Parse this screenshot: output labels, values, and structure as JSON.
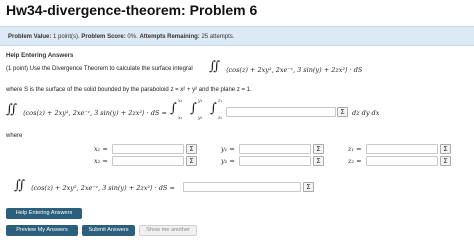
{
  "page": {
    "title": "Hw34-divergence-theorem: Problem 6"
  },
  "info_bar": {
    "value_label": "Problem Value:",
    "value": "1 point(s).",
    "score_label": "Problem Score:",
    "score": "0%.",
    "attempts_label": "Attempts Remaining:",
    "attempts": "25 attempts."
  },
  "help_header": "Help Entering Answers",
  "problem": {
    "prompt": "(1 point) Use the Divergence Theorem to calculate the surface integral",
    "vector_field": "⟨cos(z) + 2xy², 2xe⁻ᶻ, 3 sin(y) + 2zx²⟩ · dS",
    "where_text": "where S is the surface of the solid bounded by the paraboloid z = x² + y² and the plane z = 1.",
    "equation_lhs": "⟨cos(z) + 2xy², 2xe⁻ᶻ, 3 sin(y) + 2zx²⟩ · dS =",
    "integral_limits": {
      "outer_top": "x₁",
      "outer_bottom": "x₂",
      "middle_top": "y₁",
      "middle_bottom": "y₂",
      "inner_top": "z₁",
      "inner_bottom": "z₂"
    },
    "differentials": "dz dy dx",
    "where_label": "where",
    "limit_labels": {
      "x1": "x₁ =",
      "x2": "x₂ =",
      "y1": "y₁ =",
      "y2": "y₂ =",
      "z1": "z₁ =",
      "z2": "z₂ ="
    },
    "final_lhs": "⟨cos(z) + 2xy², 2xe⁻ᶻ, 3 sin(y) + 2zx²⟩ · dS ="
  },
  "icons": {
    "sigma": "Σ",
    "double_integral": "∬",
    "single_integral": "∫"
  },
  "buttons": {
    "help": "Help Entering Answers",
    "preview": "Preview My Answers",
    "submit": "Submit Answers",
    "show_me_another": "Show me another"
  },
  "colors": {
    "info_bar_bg": "#dde9f4",
    "button_dark": "#2c5f7c",
    "button_light": "#f0f0f0"
  }
}
